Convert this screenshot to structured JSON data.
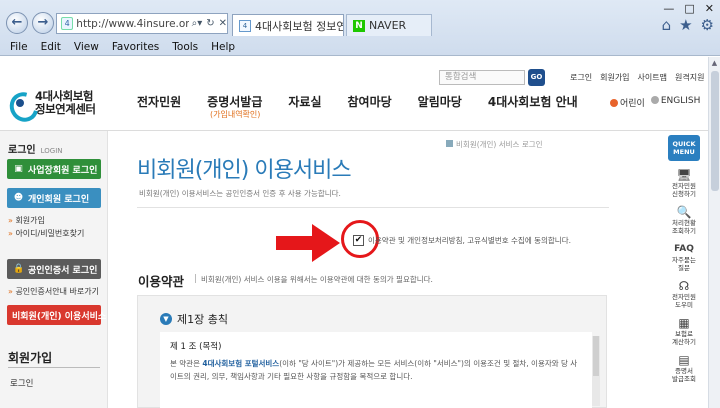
{
  "browser": {
    "back_glyph": "←",
    "forward_glyph": "→",
    "address": "http://www.4insure.or.kr/ins4/",
    "tabs": [
      {
        "label": "4대사회보험 정보연...",
        "active": true
      },
      {
        "label": "NAVER",
        "active": false
      }
    ],
    "menu": [
      "File",
      "Edit",
      "View",
      "Favorites",
      "Tools",
      "Help"
    ],
    "window_controls": [
      "—",
      "□",
      "✕"
    ]
  },
  "header": {
    "logo_line1": "4대사회보험",
    "logo_line2": "정보연계센터",
    "search_placeholder": "통합검색",
    "search_button": "GO",
    "util_links": [
      "로그인",
      "회원가입",
      "사이트맵",
      "원격지원"
    ],
    "gnb": [
      "전자민원",
      "증명서발급",
      "자료실",
      "참여마당",
      "알림마당",
      "4대사회보험 안내"
    ],
    "gnb_sub": "(가입내역확인)",
    "lang": [
      "어린이",
      "ENGLISH"
    ]
  },
  "lnb": {
    "login_title": "로그인",
    "login_en": "LOGIN",
    "biz_login": "사업장회원 로그인",
    "personal_login": "개인회원 로그인",
    "join": "회원가입",
    "find": "아이디/비밀번호찾기",
    "cert_login": "공인인증서 로그인",
    "cert_guide": "공인인증서안내 바로가기",
    "nonmember": "비회원(개인) 이용서비스",
    "join_title": "회원가입",
    "join_login": "로그인"
  },
  "main": {
    "breadcrumb": "비회원(개인) 서비스 로그인",
    "title": "비회원(개인) 이용서비스",
    "desc": "비회원(개인) 이용서비스는 공인인증서 인증 후 사용 가능합니다.",
    "agree_text": "이용약관 및 개인정보처리방침, 고유식별번호 수집에 동의합니다.",
    "agree_checked": true,
    "terms_title": "이용약관",
    "terms_desc": "비회원(개인) 서비스 이용을 위해서는 이용약관에 대한 동의가 필요합니다.",
    "chapter": "제1장 총칙",
    "article": "제 1 조 (목적)",
    "body_pre": "본 약관은 ",
    "body_hl": "4대사회보험 포털서비스",
    "body_post": "(이하 \"당 사이트\")가 제공하는 모든 서비스(이하 \"서비스\")의 이용조건 및 절차, 이용자와 당 사이트의 권리, 의무, 책임사항과 기타 필요한 사항을 규정함을 목적으로 합니다."
  },
  "quick": {
    "head_line1": "QUICK",
    "head_line2": "MENU",
    "items": [
      {
        "l1": "전자민원",
        "l2": "신청하기"
      },
      {
        "l1": "처리현황",
        "l2": "조회하기"
      },
      {
        "l1": "자주묻는",
        "l2": "질문"
      },
      {
        "l1": "전자민원",
        "l2": "도우미"
      },
      {
        "l1": "보험료",
        "l2": "계산하기"
      },
      {
        "l1": "증명서",
        "l2": "발급조회"
      }
    ]
  },
  "colors": {
    "accent": "#2a7bb8",
    "red": "#e5171a",
    "green_button": "#2f8f3a",
    "nonmember_button": "#d9382e"
  }
}
